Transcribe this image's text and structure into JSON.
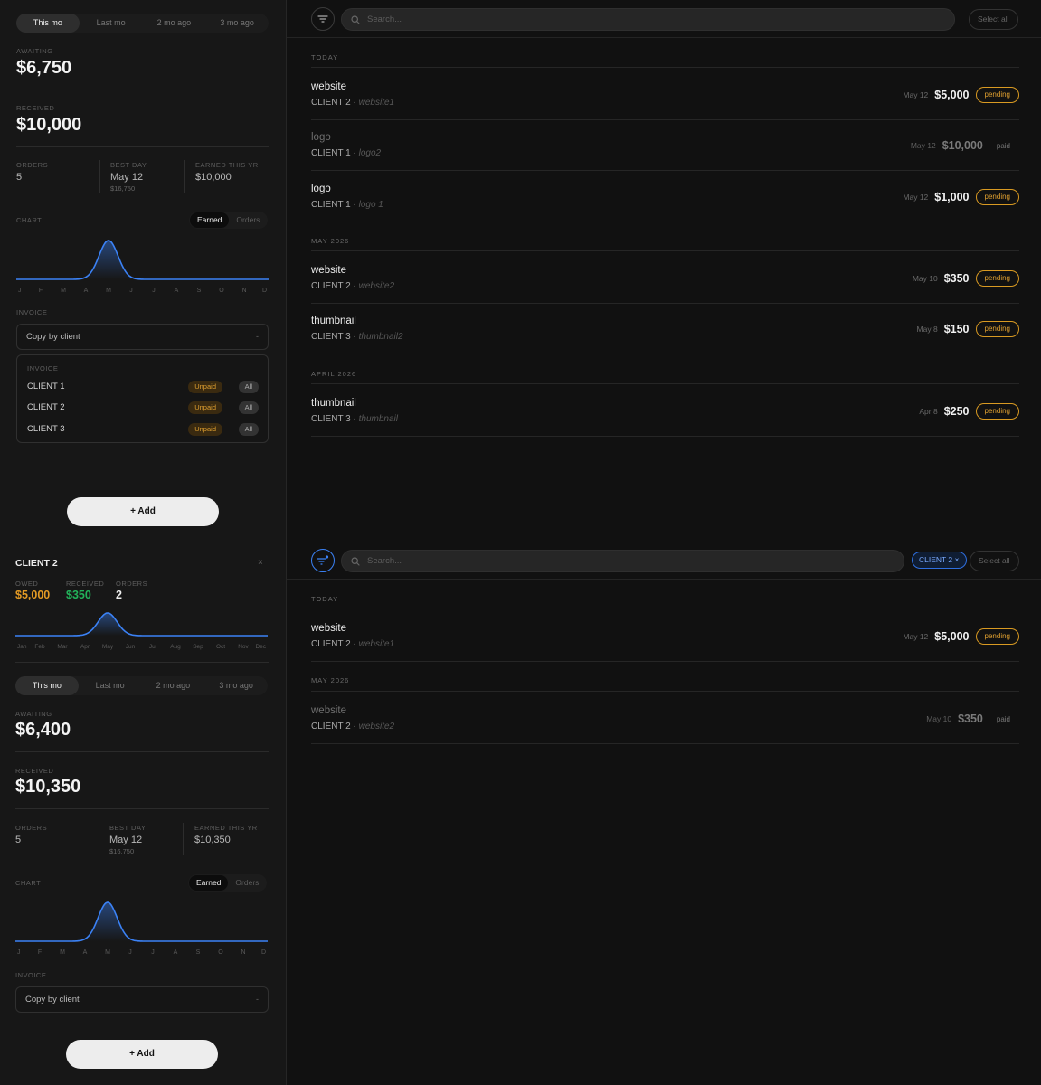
{
  "screen1": {
    "period_tabs": [
      "This mo",
      "Last mo",
      "2 mo ago",
      "3 mo ago"
    ],
    "awaiting_label": "AWAITING",
    "awaiting_value": "$6,750",
    "received_label": "RECEIVED",
    "received_value": "$10,000",
    "stats": {
      "orders_label": "ORDERS",
      "orders_value": "5",
      "best_day_label": "BEST DAY",
      "best_day_value": "May 12",
      "best_day_sub": "$16,750",
      "earned_year_label": "EARNED THIS YR",
      "earned_year_value": "$10,000"
    },
    "chart_label": "CHART",
    "chart_toggle": [
      "Earned",
      "Orders"
    ],
    "invoice_label": "INVOICE",
    "copy_select": "Copy by client",
    "copy_select_chevron": "-",
    "invoice_panel": {
      "title": "INVOICE",
      "rows": [
        {
          "client": "CLIENT 1",
          "unpaid": "Unpaid",
          "all": "All"
        },
        {
          "client": "CLIENT 2",
          "unpaid": "Unpaid",
          "all": "All"
        },
        {
          "client": "CLIENT 3",
          "unpaid": "Unpaid",
          "all": "All"
        }
      ]
    },
    "add_button": "+ Add",
    "search_placeholder": "Search...",
    "select_all": "Select all",
    "sections": [
      {
        "title": "TODAY",
        "rows": [
          {
            "title": "website",
            "client": "CLIENT 2",
            "project": "website1",
            "date": "May 12",
            "amount": "$5,000",
            "status": "pending"
          },
          {
            "title": "logo",
            "client": "CLIENT 1",
            "project": "logo2",
            "date": "May 12",
            "amount": "$10,000",
            "status": "paid"
          },
          {
            "title": "logo",
            "client": "CLIENT 1",
            "project": "logo 1",
            "date": "May 12",
            "amount": "$1,000",
            "status": "pending"
          }
        ]
      },
      {
        "title": "MAY 2026",
        "rows": [
          {
            "title": "website",
            "client": "CLIENT 2",
            "project": "website2",
            "date": "May 10",
            "amount": "$350",
            "status": "pending"
          },
          {
            "title": "thumbnail",
            "client": "CLIENT 3",
            "project": "thumbnail2",
            "date": "May 8",
            "amount": "$150",
            "status": "pending"
          }
        ]
      },
      {
        "title": "APRIL 2026",
        "rows": [
          {
            "title": "thumbnail",
            "client": "CLIENT 3",
            "project": "thumbnail",
            "date": "Apr 8",
            "amount": "$250",
            "status": "pending"
          }
        ]
      }
    ]
  },
  "screen2": {
    "client_name": "CLIENT 2",
    "close_glyph": "×",
    "owed_label": "OWED",
    "owed_value": "$5,000",
    "received_label": "RECEIVED",
    "received_value": "$350",
    "orders_label": "ORDERS",
    "orders_value": "2",
    "client_chart_months": [
      "Jan",
      "Feb",
      "Mar",
      "Apr",
      "May",
      "Jun",
      "Jul",
      "Aug",
      "Sep",
      "Oct",
      "Nov",
      "Dec"
    ],
    "period_tabs": [
      "This mo",
      "Last mo",
      "2 mo ago",
      "3 mo ago"
    ],
    "awaiting_label": "AWAITING",
    "awaiting_value": "$6,400",
    "received_total_label": "RECEIVED",
    "received_total_value": "$10,350",
    "stats": {
      "orders_label": "ORDERS",
      "orders_value": "5",
      "best_day_label": "BEST DAY",
      "best_day_value": "May 12",
      "best_day_sub": "$16,750",
      "earned_year_label": "EARNED THIS YR",
      "earned_year_value": "$10,350"
    },
    "chart_label": "CHART",
    "chart_toggle": [
      "Earned",
      "Orders"
    ],
    "invoice_label": "INVOICE",
    "copy_select": "Copy by client",
    "copy_select_chevron": "-",
    "add_button": "+ Add",
    "search_placeholder": "Search...",
    "filter_chip": "CLIENT 2 ×",
    "select_all": "Select all",
    "sections": [
      {
        "title": "TODAY",
        "rows": [
          {
            "title": "website",
            "client": "CLIENT 2",
            "project": "website1",
            "date": "May 12",
            "amount": "$5,000",
            "status": "pending"
          }
        ]
      },
      {
        "title": "MAY 2026",
        "rows": [
          {
            "title": "website",
            "client": "CLIENT 2",
            "project": "website2",
            "date": "May 10",
            "amount": "$350",
            "status": "paid"
          }
        ]
      }
    ]
  },
  "chart_data": [
    {
      "type": "area",
      "name": "earned-chart-screen1",
      "x": [
        "J",
        "F",
        "M",
        "A",
        "M",
        "J",
        "J",
        "A",
        "S",
        "O",
        "N",
        "D"
      ],
      "values": [
        0,
        0,
        0,
        0,
        1,
        0,
        0,
        0,
        0,
        0,
        0,
        0
      ]
    },
    {
      "type": "area",
      "name": "client-chart-screen2",
      "x": [
        "Jan",
        "Feb",
        "Mar",
        "Apr",
        "May",
        "Jun",
        "Jul",
        "Aug",
        "Sep",
        "Oct",
        "Nov",
        "Dec"
      ],
      "values": [
        0,
        0,
        0,
        0,
        1,
        0,
        0,
        0,
        0,
        0,
        0,
        0
      ]
    },
    {
      "type": "area",
      "name": "earned-chart-screen2",
      "x": [
        "J",
        "F",
        "M",
        "A",
        "M",
        "J",
        "J",
        "A",
        "S",
        "O",
        "N",
        "D"
      ],
      "values": [
        0,
        0,
        0,
        0,
        1,
        0,
        0,
        0,
        0,
        0,
        0,
        0
      ]
    }
  ],
  "colors": {
    "accent": "#3b82f6",
    "pending": "#e0a030",
    "owed": "#e39a24",
    "received": "#22b35a",
    "background": "#111111",
    "panel": "#171717"
  },
  "icons": {
    "filter": "filter-icon",
    "search": "search-icon",
    "close": "close-icon"
  }
}
